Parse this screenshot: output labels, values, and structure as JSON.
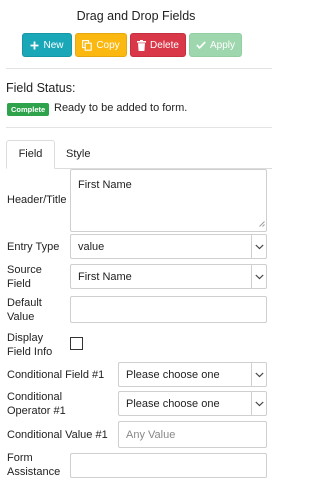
{
  "panel": {
    "title": "Drag and Drop Fields"
  },
  "toolbar": {
    "new_label": "New",
    "copy_label": "Copy",
    "delete_label": "Delete",
    "apply_label": "Apply",
    "colors": {
      "new": "#1aa8b9",
      "copy": "#fbb811",
      "delete": "#d93848",
      "apply": "#9ed6ae"
    },
    "icons": {
      "new": "plus-icon",
      "copy": "copy-icon",
      "delete": "trash-icon",
      "apply": "check-icon"
    }
  },
  "status": {
    "heading": "Field Status:",
    "badge": "Complete",
    "badge_color": "#2fa24c",
    "message": "Ready to be added to form."
  },
  "tabs": [
    {
      "label": "Field",
      "active": true
    },
    {
      "label": "Style",
      "active": false
    }
  ],
  "form": {
    "header_title": {
      "label": "Header/Title",
      "value": "First Name"
    },
    "entry_type": {
      "label": "Entry Type",
      "value": "value"
    },
    "source_field": {
      "label_line1": "Source",
      "label_line2": "Field",
      "value": "First Name"
    },
    "default_value": {
      "label_line1": "Default",
      "label_line2": "Value",
      "value": ""
    },
    "display_field_info": {
      "label_line1": "Display",
      "label_line2": "Field Info",
      "checked": false
    },
    "conditional_field_1": {
      "label": "Conditional Field #1",
      "value": "Please choose one"
    },
    "conditional_operator_1": {
      "label_line1": "Conditional",
      "label_line2": "Operator #1",
      "value": "Please choose one"
    },
    "conditional_value_1": {
      "label": "Conditional Value #1",
      "placeholder": "Any Value"
    },
    "form_assistance": {
      "label_line1": "Form",
      "label_line2": "Assistance",
      "value": ""
    }
  }
}
